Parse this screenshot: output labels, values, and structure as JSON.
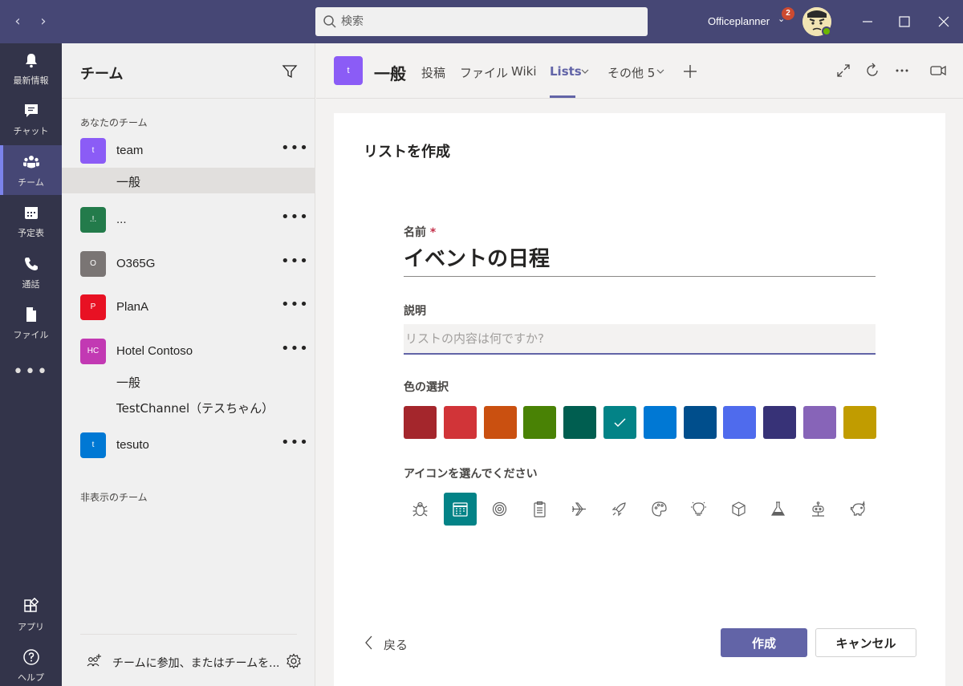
{
  "search": {
    "placeholder": "検索"
  },
  "user": {
    "name": "Officeplanner",
    "notification_count": "2"
  },
  "rail": {
    "items": [
      {
        "label": "最新情報",
        "icon": "bell-icon"
      },
      {
        "label": "チャット",
        "icon": "chat-icon"
      },
      {
        "label": "チーム",
        "icon": "teams-icon",
        "active": true
      },
      {
        "label": "予定表",
        "icon": "calendar-icon"
      },
      {
        "label": "通話",
        "icon": "phone-icon"
      },
      {
        "label": "ファイル",
        "icon": "file-icon"
      }
    ],
    "more": "•••",
    "apps_label": "アプリ",
    "help_label": "ヘルプ"
  },
  "teams_panel": {
    "title": "チーム",
    "your_teams_label": "あなたのチーム",
    "hidden_teams_label": "非表示のチーム",
    "more_glyph": "•••",
    "teams": [
      {
        "initials": "t",
        "name": "team",
        "color": "#8b5cf6",
        "channels": [
          "一般"
        ]
      },
      {
        "initials": ".!.",
        "name": "...",
        "color": "#237b4b",
        "channels": []
      },
      {
        "initials": "O",
        "name": "O365G",
        "color": "#7a7574",
        "channels": []
      },
      {
        "initials": "P",
        "name": "PlanA",
        "color": "#e81123",
        "channels": []
      },
      {
        "initials": "HC",
        "name": "Hotel Contoso",
        "color": "#c239b3",
        "channels": [
          "一般",
          "TestChannel（テスちゃん）"
        ]
      },
      {
        "initials": "t",
        "name": "tesuto",
        "color": "#0078d4",
        "channels": []
      }
    ],
    "join_text": "チームに参加、またはチームを..."
  },
  "channel_header": {
    "tile_initial": "t",
    "title": "一般",
    "tabs": [
      "投稿",
      "ファイル",
      "Wiki",
      "Lists",
      "その他 5"
    ],
    "active_tab": "Lists"
  },
  "form": {
    "title": "リストを作成",
    "name_label": "名前",
    "required_mark": "*",
    "name_value": "イベントの日程",
    "description_label": "説明",
    "description_placeholder": "リストの内容は何ですか?",
    "color_label": "色の選択",
    "colors": [
      "#a4262c",
      "#d13438",
      "#ca5010",
      "#498205",
      "#005e50",
      "#038387",
      "#0078d4",
      "#004e8c",
      "#4f6bed",
      "#373277",
      "#8764b8",
      "#c19c00"
    ],
    "selected_color_index": 5,
    "icon_label": "アイコンを選んでください",
    "icons": [
      "bug-icon",
      "calendar-icon",
      "target-icon",
      "clipboard-icon",
      "airplane-icon",
      "rocket-icon",
      "palette-icon",
      "lightbulb-icon",
      "cube-icon",
      "flask-icon",
      "robot-icon",
      "piggy-bank-icon"
    ],
    "selected_icon_index": 1,
    "back_label": "戻る",
    "create_label": "作成",
    "cancel_label": "キャンセル"
  }
}
